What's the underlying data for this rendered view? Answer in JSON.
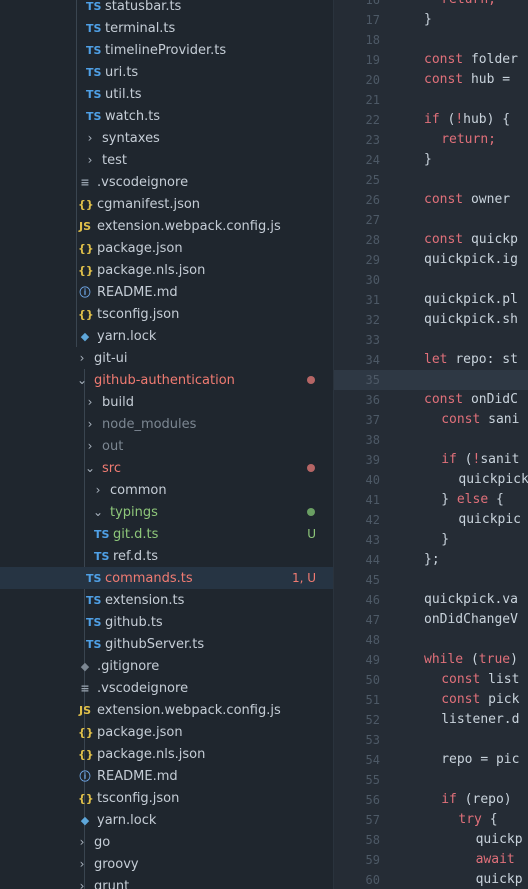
{
  "explorer": {
    "rows": [
      {
        "label": "statusbar.ts",
        "icon": "ts",
        "icon_text": "TS",
        "indent": 88
      },
      {
        "label": "terminal.ts",
        "icon": "ts",
        "icon_text": "TS",
        "indent": 88
      },
      {
        "label": "timelineProvider.ts",
        "icon": "ts",
        "icon_text": "TS",
        "indent": 88
      },
      {
        "label": "uri.ts",
        "icon": "ts",
        "icon_text": "TS",
        "indent": 88
      },
      {
        "label": "util.ts",
        "icon": "ts",
        "icon_text": "TS",
        "indent": 88
      },
      {
        "label": "watch.ts",
        "icon": "ts",
        "icon_text": "TS",
        "indent": 88
      },
      {
        "label": "syntaxes",
        "icon": "folder-closed",
        "indent": 84
      },
      {
        "label": "test",
        "icon": "folder-closed",
        "indent": 84
      },
      {
        "label": ".vscodeignore",
        "icon": "lines",
        "icon_text": "≡",
        "indent": 80
      },
      {
        "label": "cgmanifest.json",
        "icon": "json",
        "icon_text": "{}",
        "indent": 80
      },
      {
        "label": "extension.webpack.config.js",
        "icon": "js",
        "icon_text": "JS",
        "indent": 80
      },
      {
        "label": "package.json",
        "icon": "json",
        "icon_text": "{}",
        "indent": 80
      },
      {
        "label": "package.nls.json",
        "icon": "json",
        "icon_text": "{}",
        "indent": 80
      },
      {
        "label": "README.md",
        "icon": "info",
        "icon_text": "ⓘ",
        "indent": 80
      },
      {
        "label": "tsconfig.json",
        "icon": "json",
        "icon_text": "{}",
        "indent": 80
      },
      {
        "label": "yarn.lock",
        "icon": "yarn",
        "icon_text": "◆",
        "indent": 80
      },
      {
        "label": "git-ui",
        "icon": "folder-closed",
        "indent": 76
      },
      {
        "label": "github-authentication",
        "icon": "folder-open",
        "indent": 76,
        "color": "red",
        "dot": "#b56565"
      },
      {
        "label": "build",
        "icon": "folder-closed",
        "indent": 84
      },
      {
        "label": "node_modules",
        "icon": "folder-closed",
        "indent": 84,
        "color": "dim"
      },
      {
        "label": "out",
        "icon": "folder-closed",
        "indent": 84,
        "color": "dim"
      },
      {
        "label": "src",
        "icon": "folder-open",
        "indent": 84,
        "color": "red",
        "dot": "#b56565"
      },
      {
        "label": "common",
        "icon": "folder-closed",
        "indent": 92
      },
      {
        "label": "typings",
        "icon": "folder-open",
        "indent": 92,
        "color": "green",
        "dot": "#6a9f63"
      },
      {
        "label": "git.d.ts",
        "icon": "ts",
        "icon_text": "TS",
        "indent": 96,
        "color": "green",
        "badge": "U",
        "badge_color": "green"
      },
      {
        "label": "ref.d.ts",
        "icon": "ts",
        "icon_text": "TS",
        "indent": 96
      },
      {
        "label": "commands.ts",
        "icon": "ts",
        "icon_text": "TS",
        "indent": 88,
        "color": "red",
        "badge": "1, U",
        "badge_color": "red",
        "selected": true
      },
      {
        "label": "extension.ts",
        "icon": "ts",
        "icon_text": "TS",
        "indent": 88
      },
      {
        "label": "github.ts",
        "icon": "ts",
        "icon_text": "TS",
        "indent": 88
      },
      {
        "label": "githubServer.ts",
        "icon": "ts",
        "icon_text": "TS",
        "indent": 88
      },
      {
        "label": ".gitignore",
        "icon": "git",
        "icon_text": "◆",
        "indent": 80
      },
      {
        "label": ".vscodeignore",
        "icon": "lines",
        "icon_text": "≡",
        "indent": 80
      },
      {
        "label": "extension.webpack.config.js",
        "icon": "js",
        "icon_text": "JS",
        "indent": 80
      },
      {
        "label": "package.json",
        "icon": "json",
        "icon_text": "{}",
        "indent": 80
      },
      {
        "label": "package.nls.json",
        "icon": "json",
        "icon_text": "{}",
        "indent": 80
      },
      {
        "label": "README.md",
        "icon": "info",
        "icon_text": "ⓘ",
        "indent": 80
      },
      {
        "label": "tsconfig.json",
        "icon": "json",
        "icon_text": "{}",
        "indent": 80
      },
      {
        "label": "yarn.lock",
        "icon": "yarn",
        "icon_text": "◆",
        "indent": 80
      },
      {
        "label": "go",
        "icon": "folder-closed",
        "indent": 76
      },
      {
        "label": "groovy",
        "icon": "folder-closed",
        "indent": 76
      },
      {
        "label": "grunt",
        "icon": "folder-closed",
        "indent": 76
      }
    ]
  },
  "editor": {
    "current_line": 35,
    "lines": [
      {
        "n": "16",
        "code": [
          {
            "t": "return;",
            "c": "kw",
            "i": 2
          }
        ]
      },
      {
        "n": "17",
        "code": [
          {
            "t": "}",
            "c": "vr",
            "i": 0
          }
        ]
      },
      {
        "n": "18",
        "code": []
      },
      {
        "n": "19",
        "code": [
          {
            "t": "const ",
            "c": "kw",
            "i": 0
          },
          {
            "t": "folder",
            "c": "vr"
          }
        ]
      },
      {
        "n": "20",
        "code": [
          {
            "t": "const ",
            "c": "kw",
            "i": 0
          },
          {
            "t": "hub =",
            "c": "vr"
          }
        ]
      },
      {
        "n": "21",
        "code": []
      },
      {
        "n": "22",
        "code": [
          {
            "t": "if ",
            "c": "kw",
            "i": 0
          },
          {
            "t": "(",
            "c": "vr"
          },
          {
            "t": "!",
            "c": "kw"
          },
          {
            "t": "hub) {",
            "c": "vr"
          }
        ]
      },
      {
        "n": "23",
        "code": [
          {
            "t": "return;",
            "c": "kw",
            "i": 2
          }
        ]
      },
      {
        "n": "24",
        "code": [
          {
            "t": "}",
            "c": "vr",
            "i": 0
          }
        ]
      },
      {
        "n": "25",
        "code": []
      },
      {
        "n": "26",
        "code": [
          {
            "t": "const ",
            "c": "kw",
            "i": 0
          },
          {
            "t": "owner",
            "c": "vr"
          }
        ]
      },
      {
        "n": "27",
        "code": []
      },
      {
        "n": "28",
        "code": [
          {
            "t": "const ",
            "c": "kw",
            "i": 0
          },
          {
            "t": "quickp",
            "c": "vr"
          }
        ]
      },
      {
        "n": "29",
        "code": [
          {
            "t": "quickpick.ig",
            "c": "vr",
            "i": 0
          }
        ]
      },
      {
        "n": "30",
        "code": []
      },
      {
        "n": "31",
        "code": [
          {
            "t": "quickpick.pl",
            "c": "vr",
            "i": 0
          }
        ]
      },
      {
        "n": "32",
        "code": [
          {
            "t": "quickpick.sh",
            "c": "vr",
            "i": 0
          }
        ]
      },
      {
        "n": "33",
        "code": []
      },
      {
        "n": "34",
        "code": [
          {
            "t": "let ",
            "c": "kw",
            "i": 0
          },
          {
            "t": "repo: st",
            "c": "vr"
          }
        ]
      },
      {
        "n": "35",
        "code": []
      },
      {
        "n": "36",
        "code": [
          {
            "t": "const ",
            "c": "kw",
            "i": 0
          },
          {
            "t": "onDidC",
            "c": "vr"
          }
        ]
      },
      {
        "n": "37",
        "code": [
          {
            "t": "const ",
            "c": "kw",
            "i": 2
          },
          {
            "t": "sani",
            "c": "vr"
          }
        ]
      },
      {
        "n": "38",
        "code": []
      },
      {
        "n": "39",
        "code": [
          {
            "t": "if ",
            "c": "kw",
            "i": 2
          },
          {
            "t": "(",
            "c": "vr"
          },
          {
            "t": "!",
            "c": "kw"
          },
          {
            "t": "sanit",
            "c": "vr"
          }
        ]
      },
      {
        "n": "40",
        "code": [
          {
            "t": "quickpick",
            "c": "vr",
            "i": 4
          }
        ]
      },
      {
        "n": "41",
        "code": [
          {
            "t": "} ",
            "c": "vr",
            "i": 2
          },
          {
            "t": "else",
            "c": "kw"
          },
          {
            "t": " {",
            "c": "vr"
          }
        ]
      },
      {
        "n": "42",
        "code": [
          {
            "t": "quickpic",
            "c": "vr",
            "i": 4
          }
        ]
      },
      {
        "n": "43",
        "code": [
          {
            "t": "}",
            "c": "vr",
            "i": 2
          }
        ]
      },
      {
        "n": "44",
        "code": [
          {
            "t": "};",
            "c": "vr",
            "i": 0
          }
        ]
      },
      {
        "n": "45",
        "code": []
      },
      {
        "n": "46",
        "code": [
          {
            "t": "quickpick.va",
            "c": "vr",
            "i": 0
          }
        ]
      },
      {
        "n": "47",
        "code": [
          {
            "t": "onDidChangeV",
            "c": "vr",
            "i": 0
          }
        ]
      },
      {
        "n": "48",
        "code": []
      },
      {
        "n": "49",
        "code": [
          {
            "t": "while ",
            "c": "kw",
            "i": 0
          },
          {
            "t": "(",
            "c": "vr"
          },
          {
            "t": "true",
            "c": "kw"
          },
          {
            "t": ")",
            "c": "vr"
          }
        ]
      },
      {
        "n": "50",
        "code": [
          {
            "t": "const ",
            "c": "kw",
            "i": 2
          },
          {
            "t": "list",
            "c": "vr"
          }
        ]
      },
      {
        "n": "51",
        "code": [
          {
            "t": "const ",
            "c": "kw",
            "i": 2
          },
          {
            "t": "pick",
            "c": "vr"
          }
        ]
      },
      {
        "n": "52",
        "code": [
          {
            "t": "listener.d",
            "c": "vr",
            "i": 2
          }
        ]
      },
      {
        "n": "53",
        "code": []
      },
      {
        "n": "54",
        "code": [
          {
            "t": "repo = ",
            "c": "vr",
            "i": 2
          },
          {
            "t": "pic",
            "c": "vr"
          }
        ]
      },
      {
        "n": "55",
        "code": []
      },
      {
        "n": "56",
        "code": [
          {
            "t": "if ",
            "c": "kw",
            "i": 2
          },
          {
            "t": "(repo)",
            "c": "vr"
          }
        ]
      },
      {
        "n": "57",
        "code": [
          {
            "t": "try ",
            "c": "kw",
            "i": 4
          },
          {
            "t": "{",
            "c": "vr"
          }
        ]
      },
      {
        "n": "58",
        "code": [
          {
            "t": "quickp",
            "c": "vr",
            "i": 6
          }
        ]
      },
      {
        "n": "59",
        "code": [
          {
            "t": "await",
            "c": "kw",
            "i": 6
          }
        ]
      },
      {
        "n": "60",
        "code": [
          {
            "t": "quickp",
            "c": "vr",
            "i": 6
          }
        ]
      }
    ]
  }
}
